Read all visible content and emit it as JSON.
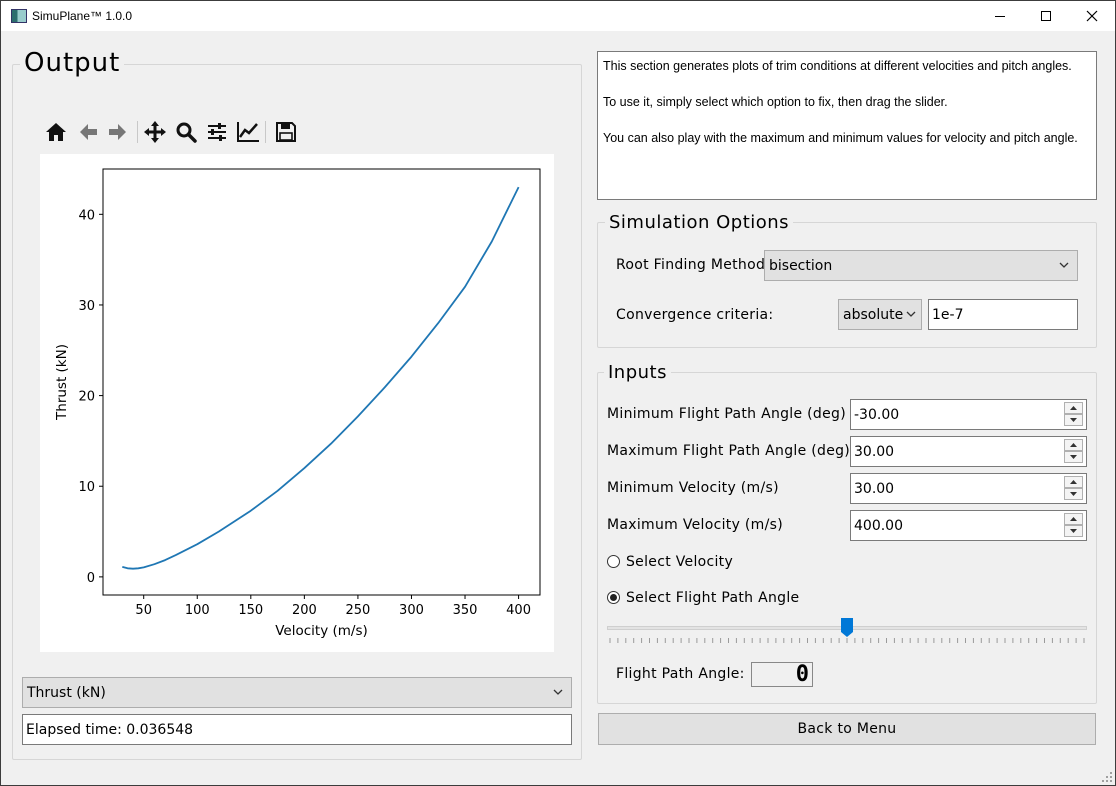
{
  "window": {
    "title": "SimuPlane™ 1.0.0"
  },
  "output": {
    "group_title": "Output",
    "toolbar": [
      "home-icon",
      "back-icon",
      "forward-icon",
      "pan-icon",
      "zoom-icon",
      "configure-subplots-icon",
      "edit-axis-icon",
      "save-icon"
    ],
    "variable_select": {
      "value": "Thrust (kN)"
    },
    "elapsed": {
      "value": "Elapsed time: 0.036548"
    }
  },
  "info": {
    "lines": [
      "This section generates plots of trim conditions at different velocities and pitch angles.",
      "To use it, simply select which option to fix, then drag the slider.",
      "You can also play with the maximum and minimum values for velocity and pitch angle."
    ]
  },
  "simulation_options": {
    "title": "Simulation Options",
    "root_label": "Root Finding Method:",
    "root_value": "bisection",
    "conv_label": "Convergence criteria:",
    "conv_type": "absolute",
    "conv_value": "1e-7"
  },
  "inputs": {
    "title": "Inputs",
    "min_fpa_label": "Minimum Flight Path Angle (deg)",
    "min_fpa_value": "-30.00",
    "max_fpa_label": "Maximum Flight Path Angle (deg)",
    "max_fpa_value": "30.00",
    "min_vel_label": "Minimum Velocity (m/s)",
    "min_vel_value": "30.00",
    "max_vel_label": "Maximum Velocity (m/s)",
    "max_vel_value": "400.00",
    "radio_velocity": "Select Velocity",
    "radio_fpa": "Select Flight Path Angle",
    "selected": "fpa",
    "slider_value_fraction": 0.5,
    "fpa_label": "Flight Path Angle:",
    "fpa_display": "0"
  },
  "back_button": "Back to Menu",
  "chart_data": {
    "type": "line",
    "xlabel": "Velocity (m/s)",
    "ylabel": "Thrust (kN)",
    "xlim": [
      12,
      420
    ],
    "ylim": [
      -2,
      45
    ],
    "xticks": [
      50,
      100,
      150,
      200,
      250,
      300,
      350,
      400
    ],
    "yticks": [
      0,
      10,
      20,
      30,
      40
    ],
    "color": "#1f77b4",
    "series": [
      {
        "x": [
          30,
          35,
          40,
          45,
          50,
          60,
          70,
          80,
          100,
          120,
          150,
          175,
          200,
          225,
          250,
          275,
          300,
          325,
          350,
          375,
          400
        ],
        "y": [
          1.1,
          0.95,
          0.9,
          0.95,
          1.05,
          1.4,
          1.85,
          2.4,
          3.6,
          5.0,
          7.3,
          9.5,
          12.0,
          14.7,
          17.7,
          20.9,
          24.3,
          28.0,
          32.0,
          37.0,
          43.0
        ]
      }
    ]
  }
}
